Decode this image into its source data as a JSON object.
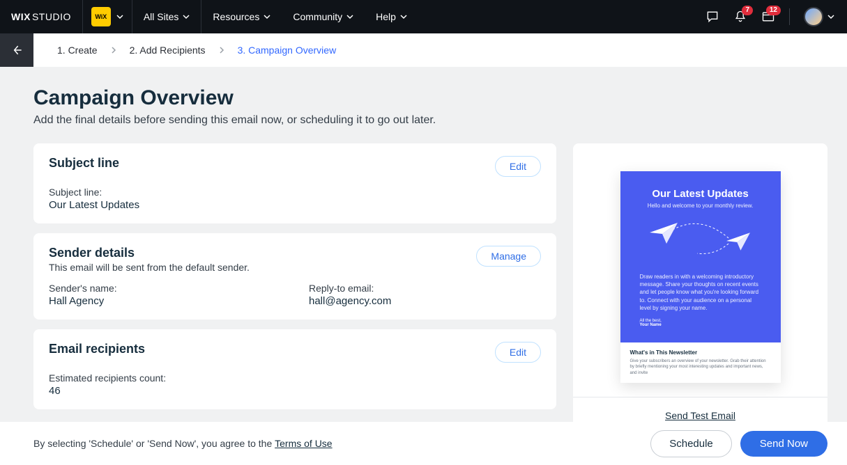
{
  "topbar": {
    "brand_a": "WIX",
    "brand_b": "STUDIO",
    "site_icon_text": "WiX",
    "nav": {
      "all_sites": "All Sites",
      "resources": "Resources",
      "community": "Community",
      "help": "Help"
    },
    "badges": {
      "bell": "7",
      "inbox": "12"
    }
  },
  "breadcrumbs": {
    "step1": "1. Create",
    "step2": "2. Add Recipients",
    "step3": "3. Campaign Overview"
  },
  "page": {
    "title": "Campaign Overview",
    "subtitle": "Add the final details before sending this email now, or scheduling it to go out later."
  },
  "subject_card": {
    "title": "Subject line",
    "edit": "Edit",
    "label": "Subject line:",
    "value": "Our Latest Updates"
  },
  "sender_card": {
    "title": "Sender details",
    "sub": "This email will be sent from the default sender.",
    "manage": "Manage",
    "name_label": "Sender's name:",
    "name_value": "Hall Agency",
    "reply_label": "Reply-to email:",
    "reply_value": "hall@agency.com"
  },
  "recipients_card": {
    "title": "Email recipients",
    "edit": "Edit",
    "count_label": "Estimated recipients count:",
    "count_value": "46"
  },
  "preview": {
    "hero_title": "Our Latest Updates",
    "hero_sub": "Hello and welcome to your monthly review.",
    "para": "Draw readers in with a welcoming introductory message. Share your thoughts on recent events and let people know what you're looking forward to. Connect with your audience on a personal level by signing your name.",
    "sign1": "All the best,",
    "sign2": "Your Name",
    "section_title": "What's in This Newsletter",
    "section_body": "Give your subscribers an overview of your newsletter. Grab their attention by briefly mentioning your most interesting updates and important news, and invite",
    "send_test": "Send Test Email"
  },
  "footer": {
    "terms_prefix": "By selecting 'Schedule' or 'Send Now', you agree to the ",
    "terms_link": "Terms of Use",
    "schedule": "Schedule",
    "send_now": "Send Now"
  }
}
